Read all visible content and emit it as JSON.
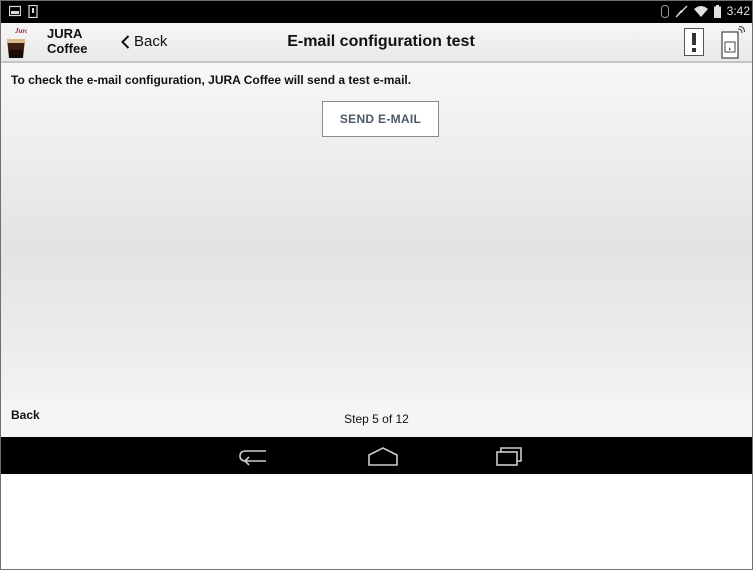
{
  "status_bar": {
    "time": "3:42",
    "left_icons": [
      "image-notification-icon",
      "phone-notification-icon"
    ],
    "right_icons": [
      "bluetooth-icon",
      "mute-icon",
      "wifi-icon",
      "battery-icon"
    ]
  },
  "header": {
    "app_name_line1": "JURA",
    "app_name_line2": "Coffee",
    "back_label": "Back",
    "title": "E-mail configuration test",
    "alert_icon": "exclamation-icon",
    "machine_icon": "coffee-machine-icon"
  },
  "content": {
    "info_text": "To check the e-mail configuration, JURA Coffee will send a test e-mail.",
    "send_button_label": "SEND E-MAIL"
  },
  "footer": {
    "back_label": "Back",
    "step_text": "Step 5 of 12"
  },
  "nav_bar": {
    "icons": [
      "back-nav-icon",
      "home-nav-icon",
      "recents-nav-icon"
    ]
  },
  "colors": {
    "status_bar_bg": "#000000",
    "nav_bar_bg": "#000000",
    "logo_red": "#c8102e",
    "button_text": "#4e5a68"
  }
}
